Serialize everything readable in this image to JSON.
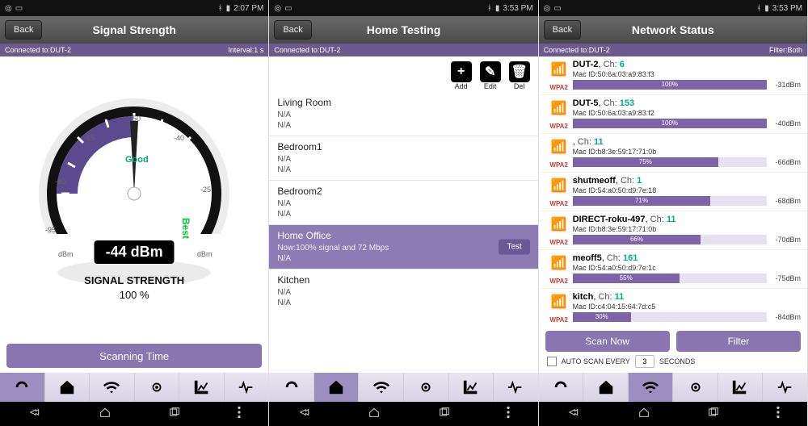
{
  "status": {
    "time1": "2:07 PM",
    "time2": "3:53 PM",
    "time3": "3:53 PM",
    "bt": "bluetooth",
    "batt": "battery"
  },
  "p1": {
    "title": "Signal Strength",
    "back": "Back",
    "connected": "Connected to:DUT-2",
    "interval": "Interval:1 s",
    "good": "Good",
    "best": "Best",
    "dbm": "-44 dBm",
    "strength_label": "SIGNAL STRENGTH",
    "strength_pct": "100 %",
    "ticks": {
      "t50": "-50",
      "t40": "-40",
      "t25": "-25",
      "t65": "-65",
      "t80": "-80",
      "t95": "-95",
      "dbmL": "dBm",
      "dbmR": "dBm"
    },
    "bottom_btn": "Scanning Time"
  },
  "p2": {
    "title": "Home Testing",
    "back": "Back",
    "connected": "Connected to:DUT-2",
    "tools": {
      "add": "Add",
      "edit": "Edit",
      "del": "Del"
    },
    "rooms": [
      {
        "name": "Living Room",
        "l1": "N/A",
        "l2": "N/A",
        "selected": false
      },
      {
        "name": "Bedroom1",
        "l1": "N/A",
        "l2": "N/A",
        "selected": false
      },
      {
        "name": "Bedroom2",
        "l1": "N/A",
        "l2": "N/A",
        "selected": false
      },
      {
        "name": "Home Office",
        "l1": "Now:100% signal and 72 Mbps",
        "l2": "N/A",
        "selected": true
      },
      {
        "name": "Kitchen",
        "l1": "N/A",
        "l2": "N/A",
        "selected": false
      }
    ],
    "test_btn": "Test"
  },
  "p3": {
    "title": "Network Status",
    "back": "Back",
    "connected": "Connected to:DUT-2",
    "filter": "Filter:Both",
    "wpa": "WPA2",
    "ch_lbl": "Ch:",
    "mac_lbl": "Mac ID:",
    "networks": [
      {
        "name": "DUT-2",
        "ch": "6",
        "mac": "50:6a:03:a9:83:f3",
        "pct": 100,
        "dbm": "-31dBm"
      },
      {
        "name": "DUT-5",
        "ch": "153",
        "mac": "50:6a:03:a9:83:f2",
        "pct": 100,
        "dbm": "-40dBm"
      },
      {
        "name": "",
        "ch": "11",
        "mac": "b8:3e:59:17:71:0b",
        "pct": 75,
        "dbm": "-66dBm"
      },
      {
        "name": "shutmeoff",
        "ch": "1",
        "mac": "54:a0:50:d9:7e:18",
        "pct": 71,
        "dbm": "-68dBm"
      },
      {
        "name": "DIRECT-roku-497",
        "ch": "11",
        "mac": "b8:3e:59:17:71:0b",
        "pct": 66,
        "dbm": "-70dBm"
      },
      {
        "name": "meoff5",
        "ch": "161",
        "mac": "54:a0:50:d9:7e:1c",
        "pct": 55,
        "dbm": "-75dBm"
      },
      {
        "name": "kitch",
        "ch": "11",
        "mac": "c4:04:15:64:7d:c5",
        "pct": 30,
        "dbm": "-84dBm"
      }
    ],
    "scan_btn": "Scan Now",
    "filter_btn": "Filter",
    "autoscan_lbl": "AUTO SCAN EVERY",
    "autoscan_val": "3",
    "seconds_lbl": "SECONDS"
  },
  "tabs": [
    "gauge",
    "home",
    "wifi",
    "target",
    "chart",
    "pulse"
  ],
  "nav": {
    "back": "back",
    "home": "home",
    "recent": "recent",
    "menu": "menu"
  }
}
